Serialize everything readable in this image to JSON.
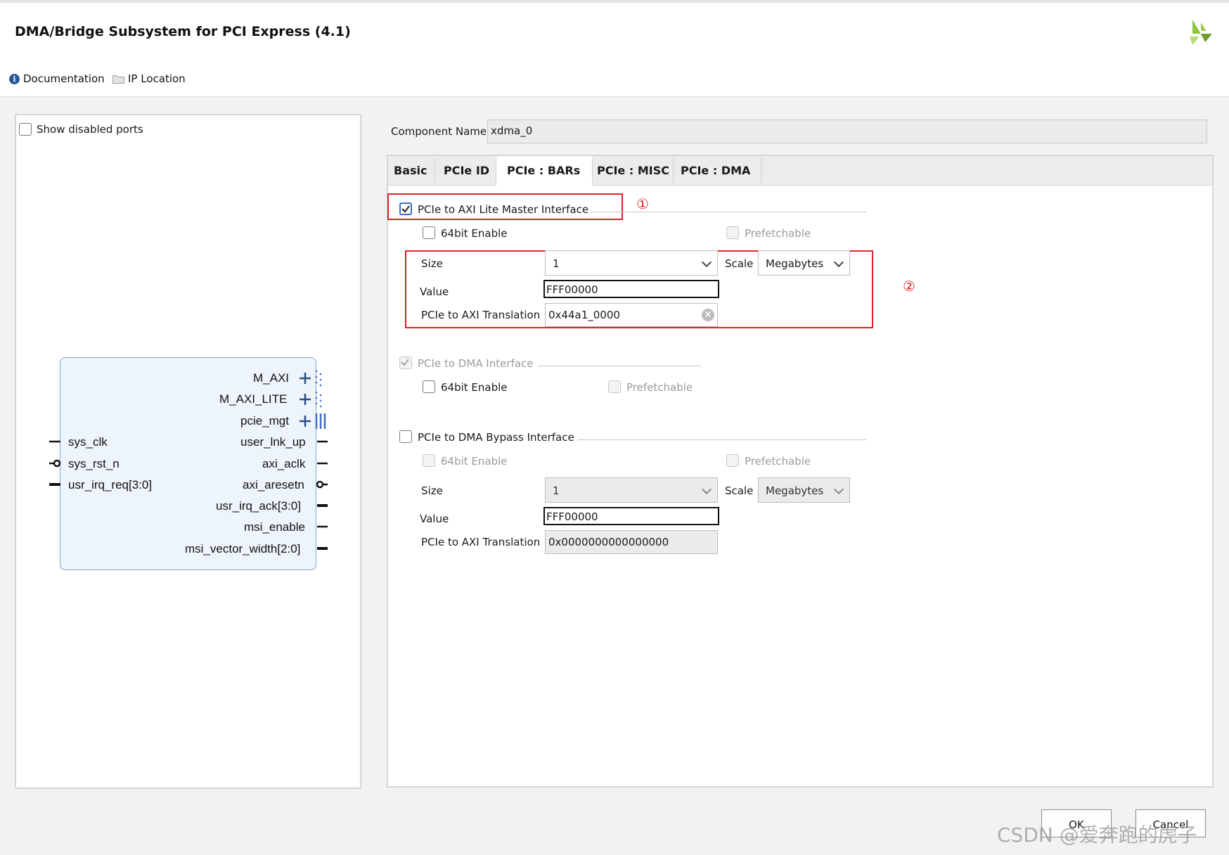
{
  "window": {
    "title": "DMA/Bridge Subsystem for PCI Express (4.1)",
    "logo_icon": "xilinx-logo-icon"
  },
  "toolbar": {
    "documentation_label": "Documentation",
    "ip_location_label": "IP Location"
  },
  "left_panel": {
    "show_disabled_ports_label": "Show disabled ports",
    "show_disabled_ports_checked": false,
    "block": {
      "right_bus_ports": [
        "M_AXI",
        "M_AXI_LITE",
        "pcie_mgt"
      ],
      "left_ports": [
        "sys_clk",
        "sys_rst_n",
        "usr_irq_req[3:0]"
      ],
      "right_ports": [
        "user_lnk_up",
        "axi_aclk",
        "axi_aresetn",
        "usr_irq_ack[3:0]",
        "msi_enable",
        "msi_vector_width[2:0]"
      ]
    }
  },
  "component": {
    "label": "Component Name",
    "value": "xdma_0"
  },
  "tabs": [
    {
      "label": "Basic",
      "active": false
    },
    {
      "label": "PCIe ID",
      "active": false
    },
    {
      "label": "PCIe : BARs",
      "active": true
    },
    {
      "label": "PCIe : MISC",
      "active": false
    },
    {
      "label": "PCIe : DMA",
      "active": false
    }
  ],
  "bars": {
    "axi_lite": {
      "label": "PCIe to AXI Lite Master Interface",
      "checked": true,
      "annotation": "①",
      "enable64_label": "64bit Enable",
      "prefetchable_label": "Prefetchable",
      "size_label": "Size",
      "size_value": "1",
      "scale_label": "Scale",
      "scale_value": "Megabytes",
      "value_label": "Value",
      "value": "FFF00000",
      "translation_label": "PCIe to AXI Translation",
      "translation_value": "0x44a1_0000",
      "annotation2": "②"
    },
    "dma": {
      "label": "PCIe to DMA Interface",
      "checked": true,
      "enable64_label": "64bit Enable",
      "prefetchable_label": "Prefetchable"
    },
    "dma_bypass": {
      "label": "PCIe to DMA Bypass Interface",
      "checked": false,
      "enable64_label": "64bit Enable",
      "prefetchable_label": "Prefetchable",
      "size_label": "Size",
      "size_value": "1",
      "scale_label": "Scale",
      "scale_value": "Megabytes",
      "value_label": "Value",
      "value": "FFF00000",
      "translation_label": "PCIe to AXI Translation",
      "translation_value": "0x0000000000000000"
    }
  },
  "footer": {
    "ok_label": "OK",
    "cancel_label": "Cancel",
    "watermark": "CSDN @爱奔跑的虎子"
  },
  "colors": {
    "annotation_red": "#e0202a",
    "checkbox_blue": "#3b6cc9",
    "block_fill": "#eef4fb"
  }
}
